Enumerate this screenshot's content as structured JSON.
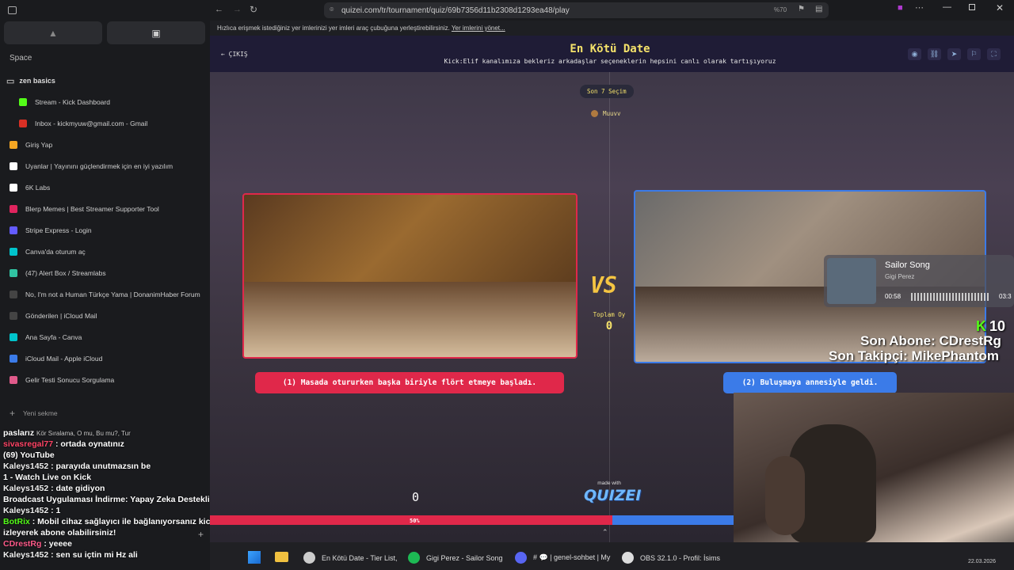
{
  "browser": {
    "url": "quizei.com/tr/tournament/quiz/69b7356d11b2308d1293ea48/play",
    "zoom": "%70",
    "bookmark_text": "Hızlıca erişmek istediğiniz yer imlerinizi yer imleri araç çubuğuna yerleştirebilirsiniz.",
    "bookmark_link": "Yer imlerini yönet..."
  },
  "sidebar": {
    "space_label": "Space",
    "folder": "zen basics",
    "tabs": [
      {
        "label": "Stream - Kick Dashboard",
        "color": "#53fc18"
      },
      {
        "label": "Inbox - kickmyuw@gmail.com - Gmail",
        "color": "#d93025"
      },
      {
        "label": "Giriş Yap",
        "color": "#f5a623"
      },
      {
        "label": "Uyanlar | Yayınını güçlendirmek için en iyi yazılım",
        "color": "#ffffff"
      },
      {
        "label": "6K Labs",
        "color": "#ffffff"
      },
      {
        "label": "Blerp Memes | Best Streamer Supporter Tool",
        "color": "#e0245e"
      },
      {
        "label": "Stripe Express - Login",
        "color": "#635bff"
      },
      {
        "label": "Canva'da oturum aç",
        "color": "#00c4cc"
      },
      {
        "label": "(47) Alert Box / Streamlabs",
        "color": "#31c3a2"
      },
      {
        "label": "No, I'm not a Human Türkçe Yama | DonanimHaber Forum",
        "color": "#444444"
      },
      {
        "label": "Gönderilen | iCloud Mail",
        "color": "#444444"
      },
      {
        "label": "Ana Sayfa - Canva",
        "color": "#00c4cc"
      },
      {
        "label": "iCloud Mail - Apple iCloud",
        "color": "#3b7be8"
      },
      {
        "label": "Gelir Testi Sonucu Sorgulama",
        "color": "#e05a8a"
      }
    ],
    "new_tab": "Yeni sekme"
  },
  "chat": [
    {
      "user": "",
      "msg": "paslarız",
      "extra": "Kör Sıralama, O mu, Bu mu?, Tur"
    },
    {
      "user": "sivasregal77",
      "msg": ": ortada oynatınız"
    },
    {
      "user": "",
      "msg": "(69) YouTube"
    },
    {
      "user": "Kaleys1452",
      "msg": ": parayıda unutmazsın be"
    },
    {
      "user": "",
      "msg": "1 - Watch Live on Kick"
    },
    {
      "user": "Kaleys1452",
      "msg": ": date gidiyon"
    },
    {
      "user": "",
      "msg": "Broadcast Uygulaması İndirme: Yapay Zeka Destekli Ses"
    },
    {
      "user": "Kaleys1452",
      "msg": ": 1"
    },
    {
      "user": "BotRix",
      "msg": ": Mobil cihaz sağlayıcı ile bağlanıyorsanız kick.com/"
    },
    {
      "user": "",
      "msg": "izleyerek abone olabilirsiniz!"
    },
    {
      "user": "CDrestRg",
      "msg": ": yeeee"
    },
    {
      "user": "Kaleys1452",
      "msg": ": sen su içtin mi Hz ali"
    }
  ],
  "quiz": {
    "back": "ÇIKIŞ",
    "title": "En Kötü Date",
    "subtitle": "Kick:Elif kanalımıza bekleriz arkadaşlar seçeneklerin hepsini canlı olarak tartışıyoruz",
    "round": "Son 7 Seçim",
    "username": "Muuvv",
    "option1": "(1) Masada otururken başka biriyle flört etmeye başladı.",
    "option2": "(2) Buluşmaya annesiyle geldi.",
    "vs": "VS",
    "total_label": "Toplam Oy",
    "total_value": "0",
    "left_count": "0",
    "made_with": "made with",
    "logo": "QUIZEI",
    "percent": "50%",
    "split": 0.5
  },
  "overlay": {
    "song": "Sailor Song",
    "artist": "Gigi Perez",
    "time_current": "00:58",
    "time_total": "03:3",
    "kick_count": "10",
    "last_sub": "Son Abone: CDrestRg",
    "last_follow": "Son Takipçi: MikePhantom"
  },
  "taskbar": [
    {
      "label": "En Kötü Date - Tier List,",
      "color": "#cccccc"
    },
    {
      "label": "Gigi Perez - Sailor Song",
      "color": "#1db954"
    },
    {
      "label": "# 💬 | genel-sohbet | My",
      "color": "#5865f2"
    },
    {
      "label": "OBS 32.1.0 - Profil: İsims",
      "color": "#dddddd"
    }
  ],
  "date": "22.03.2026"
}
